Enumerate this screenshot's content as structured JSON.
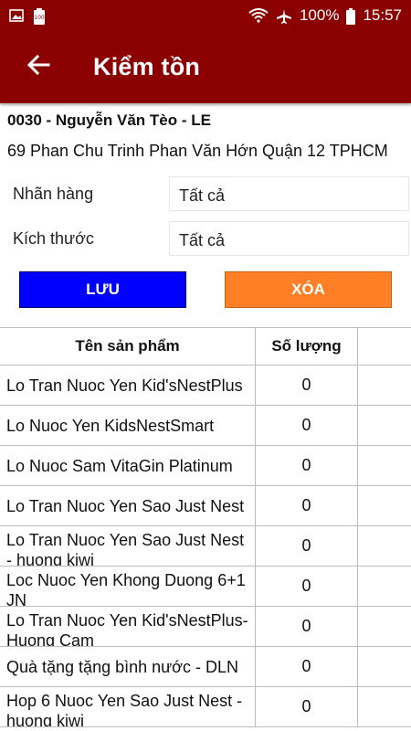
{
  "status_bar": {
    "left_icons": [
      "image-icon",
      "battery-saver-icon"
    ],
    "battery": "100%",
    "time": "15:57"
  },
  "app_bar": {
    "title": "Kiểm tồn"
  },
  "customer": {
    "title": "0030 - Nguyễn Văn Tèo - LE",
    "address": "69 Phan Chu Trinh Phan Văn Hớn Quận 12 TPHCM"
  },
  "filters": {
    "brand_label": "Nhãn hàng",
    "brand_value": "Tất cả",
    "size_label": "Kích thước",
    "size_value": "Tất cả"
  },
  "buttons": {
    "save": "LƯU",
    "delete": "XÓA"
  },
  "table": {
    "headers": {
      "name": "Tên sản phẩm",
      "qty": "Số lượng"
    },
    "rows": [
      {
        "name": "Lo Tran Nuoc Yen Kid'sNestPlus",
        "qty": "0"
      },
      {
        "name": "Lo Nuoc Yen KidsNestSmart",
        "qty": "0"
      },
      {
        "name": "Lo Nuoc Sam VitaGin Platinum",
        "qty": "0"
      },
      {
        "name": "Lo Tran Nuoc Yen Sao Just Nest",
        "qty": "0"
      },
      {
        "name": "Lo Tran Nuoc Yen Sao Just Nest - huong kiwi",
        "qty": "0"
      },
      {
        "name": "Loc Nuoc Yen Khong Duong 6+1 JN",
        "qty": "0"
      },
      {
        "name": "Lo Tran Nuoc Yen Kid'sNestPlus-Huong Cam",
        "qty": "0"
      },
      {
        "name": "Quà tặng tặng bình nước - DLN",
        "qty": "0"
      },
      {
        "name": "Hop 6 Nuoc Yen Sao Just Nest - huong kiwi",
        "qty": "0"
      }
    ]
  },
  "colors": {
    "primary": "#8b0000",
    "save_button": "#0000ff",
    "delete_button": "#ff7f27"
  }
}
